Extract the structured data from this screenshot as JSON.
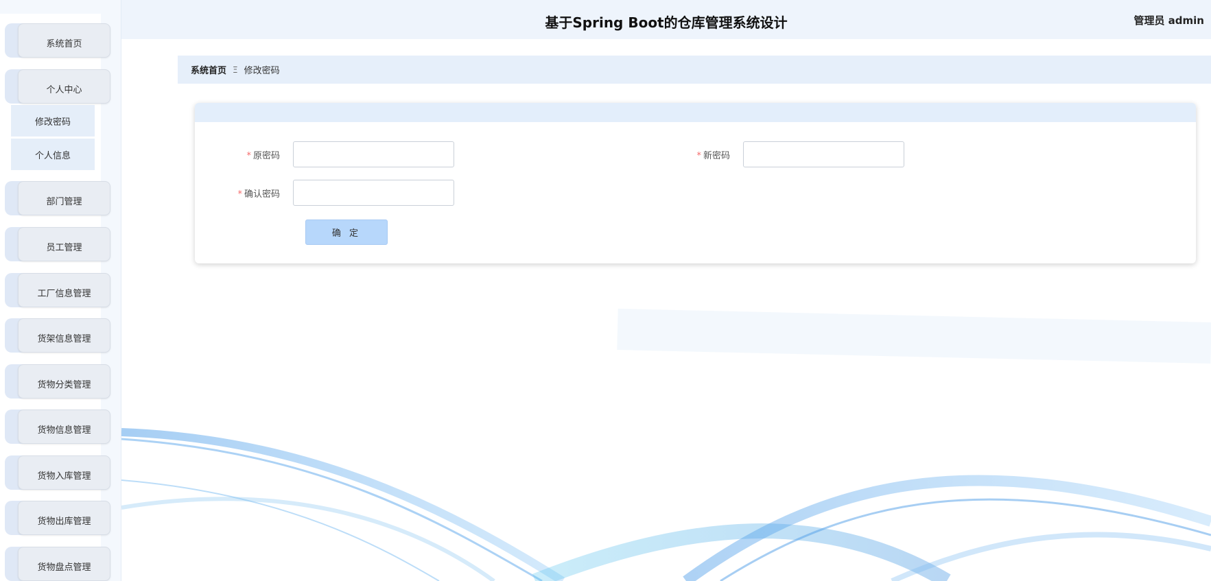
{
  "header": {
    "title": "基于Spring Boot的仓库管理系统设计",
    "user_label": "管理员 admin"
  },
  "sidebar": {
    "items": [
      {
        "label": "系统首页"
      },
      {
        "label": "个人中心",
        "children": [
          {
            "label": "修改密码"
          },
          {
            "label": "个人信息"
          }
        ]
      },
      {
        "label": "部门管理"
      },
      {
        "label": "员工管理"
      },
      {
        "label": "工厂信息管理"
      },
      {
        "label": "货架信息管理"
      },
      {
        "label": "货物分类管理"
      },
      {
        "label": "货物信息管理"
      },
      {
        "label": "货物入库管理"
      },
      {
        "label": "货物出库管理"
      },
      {
        "label": "货物盘点管理"
      }
    ]
  },
  "breadcrumb": {
    "home": "系统首页",
    "separator": "Ξ",
    "current": "修改密码"
  },
  "form": {
    "fields": [
      {
        "label": "原密码",
        "required_mark": "*",
        "value": ""
      },
      {
        "label": "新密码",
        "required_mark": "*",
        "value": ""
      },
      {
        "label": "确认密码",
        "required_mark": "*",
        "value": ""
      }
    ],
    "submit_label": "确 定"
  },
  "colors": {
    "accent": "#b7d7fb",
    "required": "#f56c6c",
    "header_bg": "#eef4fc"
  }
}
